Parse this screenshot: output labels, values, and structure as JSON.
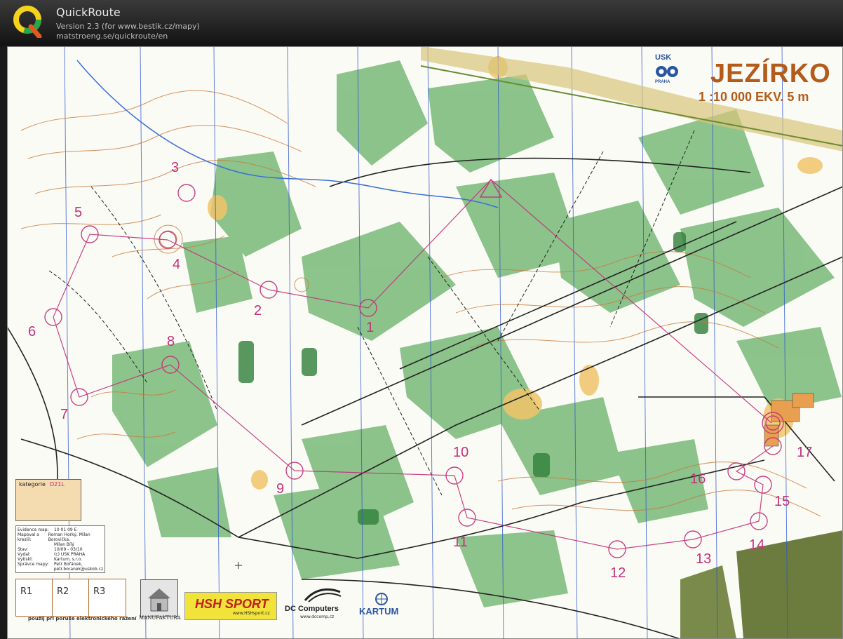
{
  "app": {
    "title": "QuickRoute",
    "version_line": "Version 2.3  (for www.bestik.cz/mapy)",
    "url_line": "matstroeng.se/quickroute/en"
  },
  "map": {
    "title": "JEZÍRKO",
    "scale": "1 :10 000 EKV. 5 m",
    "club_text": "USK",
    "club_sub": "PRAHA",
    "category_label": "kategorie",
    "category_value": "D21L",
    "info": [
      {
        "k": "Evidence map:",
        "v": "10 01 09 E"
      },
      {
        "k": "Mapoval a kreslil:",
        "v": "Roman Horký, Milan Borovička,"
      },
      {
        "k": "",
        "v": "Milan Bílý"
      },
      {
        "k": "Stav:",
        "v": "10/09 - 03/10"
      },
      {
        "k": "Vydal:",
        "v": "(c) USK PRAHA"
      },
      {
        "k": "Vytiskl:",
        "v": "Kartum, s.r.o."
      },
      {
        "k": "Správce mapy:",
        "v": "Petr Bořánek,"
      },
      {
        "k": "",
        "v": "petr.boranek@uskob.cz"
      }
    ],
    "r_boxes": [
      "R1",
      "R2",
      "R3"
    ],
    "r_note": "použij při poruše elektronického ražení",
    "sponsors": {
      "manufaktura": "MANUFAKTURA",
      "hsh": "HSH SPORT",
      "hsh_url": "www.HSHsport.cz",
      "dc": "DC Computers",
      "dc_url": "www.dccomp.cz",
      "kartum": "KARTUM"
    },
    "controls": [
      "1",
      "2",
      "3",
      "4",
      "5",
      "6",
      "7",
      "8",
      "9",
      "10",
      "11",
      "12",
      "13",
      "14",
      "15",
      "16",
      "17"
    ],
    "colors": {
      "course": "#c2307a",
      "green": "#5fae5f",
      "contour": "#c8793a",
      "yellow": "#f1c46a",
      "water": "#3a6fd6"
    }
  }
}
